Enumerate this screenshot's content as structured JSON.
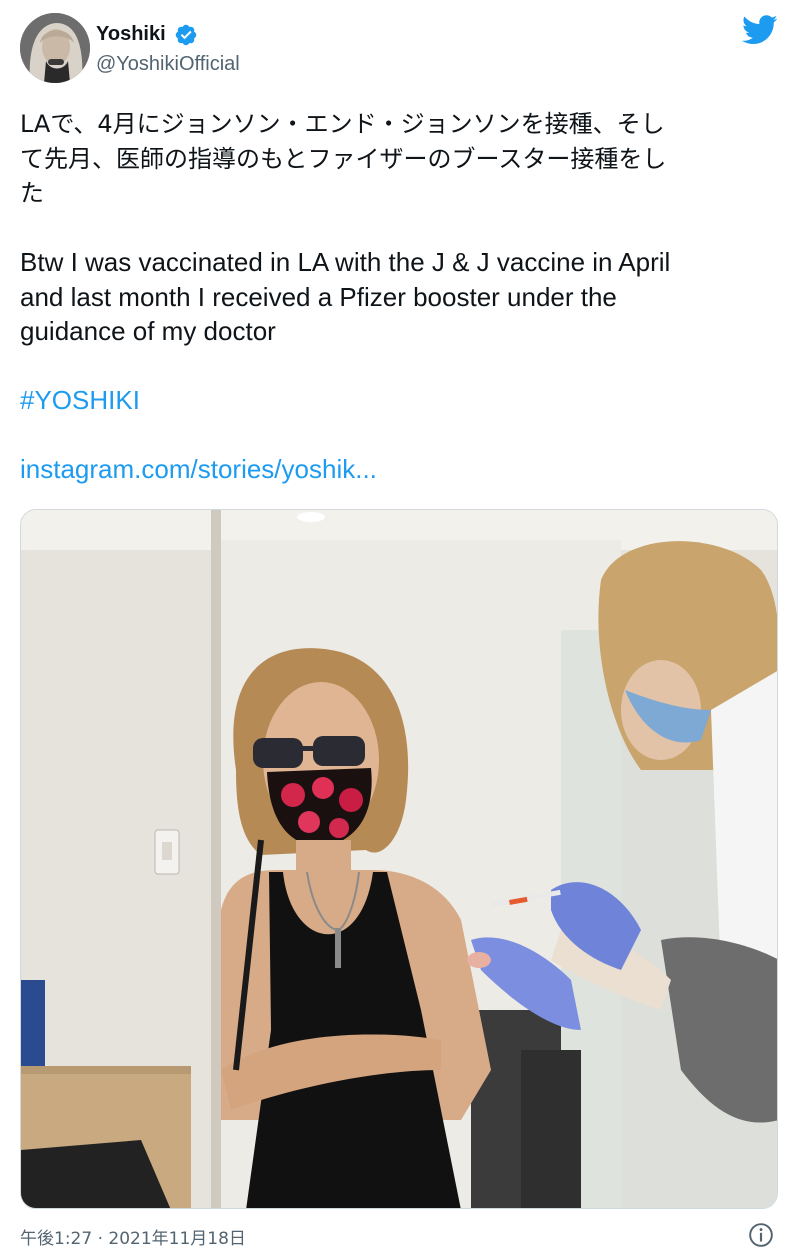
{
  "author": {
    "display_name": "Yoshiki",
    "handle": "@YoshikiOfficial",
    "verified": true,
    "avatar_icon": "profile-photo"
  },
  "brand_icon": "twitter-bird-icon",
  "tweet": {
    "jp_line1": "LAで、4月にジョンソン・エンド・ジョンソンを接種、そし",
    "jp_line2": "て先月、医師の指導のもとファイザーのブースター接種をし",
    "jp_line3": "た",
    "en_line1": "Btw I was vaccinated in LA with the J & J vaccine in April",
    "en_line2": "and last month I received a Pfizer booster under the",
    "en_line3": "guidance of my doctor",
    "hashtag": "#YOSHIKI",
    "link": "instagram.com/stories/yoshik..."
  },
  "media": {
    "type": "photo"
  },
  "footer": {
    "timestamp": "午後1:27 · 2021年11月18日",
    "info_icon": "info-icon"
  },
  "colors": {
    "link": "#1d9bf0",
    "secondary_text": "#536471",
    "primary_text": "#0f1419",
    "verified": "#1d9bf0"
  }
}
